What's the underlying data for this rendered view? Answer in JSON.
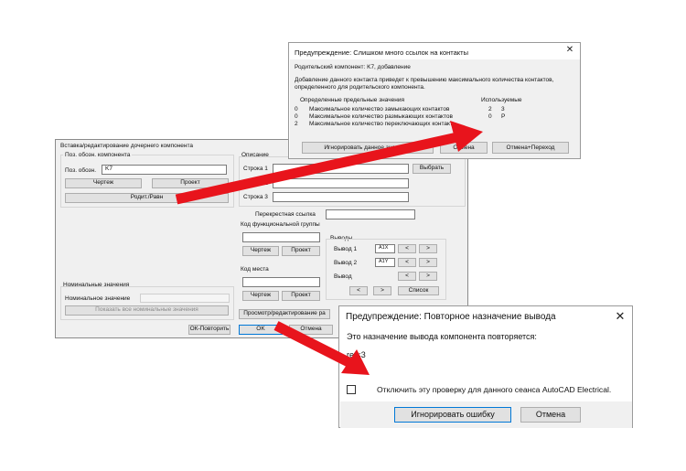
{
  "main": {
    "title": "Вставка/редактирование дочернего компонента",
    "tag_group": "Поз. обозн. компонента",
    "tag_label": "Поз. обозн.",
    "tag_value": "K7",
    "drawing_btn": "Чертеж",
    "project_btn": "Проект",
    "parent_btn": "Родит./Равн",
    "desc_group": "Описание",
    "line1": "Строка 1",
    "line2": "Строка 2",
    "line3": "Строка 3",
    "select_btn": "Выбрать",
    "xref_label": "Перекрестная ссылка",
    "func_group": "Код функциональной группы",
    "loc_group": "Код места",
    "pins_group": "Выводы",
    "pin1": "Вывод 1",
    "pin1_value": "A1X",
    "pin2": "Вывод 2",
    "pin2_value": "A1Y",
    "pin": "Вывод",
    "list_btn": "Список",
    "ratings_group": "Номинальные значения",
    "rating_label": "Номинальное значение",
    "show_all_btn": "Показать все номинальные значения",
    "ok_repeat_btn": "ОК-Повторить",
    "ok_btn": "OK",
    "cancel_btn": "Отмена",
    "browse_btn": "Просмотр/редактирование ра",
    "prev": "<",
    "next": ">"
  },
  "warn1": {
    "title": "Предупреждение: Слишком много ссылок на контакты",
    "parent": "Родительский компонент: K7, добавление",
    "message": "Добавление данного контакта приведет к превышению максимального количества контактов, определенного для родительского компонента.",
    "col_limits": "Определенные предельные значения",
    "col_used": "Используемые",
    "rows": [
      {
        "limit": "0",
        "label": "Максимальное количество замыкающих контактов",
        "used": "2",
        "ref": "3"
      },
      {
        "limit": "0",
        "label": "Максимальное количество размыкающих контактов",
        "used": "0",
        "ref": "P"
      },
      {
        "limit": "2",
        "label": "Максимальное количество переключающих контакт",
        "used": "",
        "ref": ""
      }
    ],
    "ignore_btn": "Игнорировать данное значение",
    "cancel_btn": "Отмена",
    "cancel_goto_btn": "Отмена+Переход"
  },
  "warn2": {
    "title": "Предупреждение: Повторное назначение вывода",
    "message": "Это назначение вывода компонента повторяется:",
    "detail": "ref=3",
    "checkbox_label": "Отключить эту проверку для данного сеанса AutoCAD Electrical.",
    "ignore_btn": "Игнорировать ошибку",
    "cancel_btn": "Отмена"
  },
  "colors": {
    "arrow": "#e8141c",
    "focus": "#0078d7",
    "dialog_bg": "#f0f0f0"
  }
}
